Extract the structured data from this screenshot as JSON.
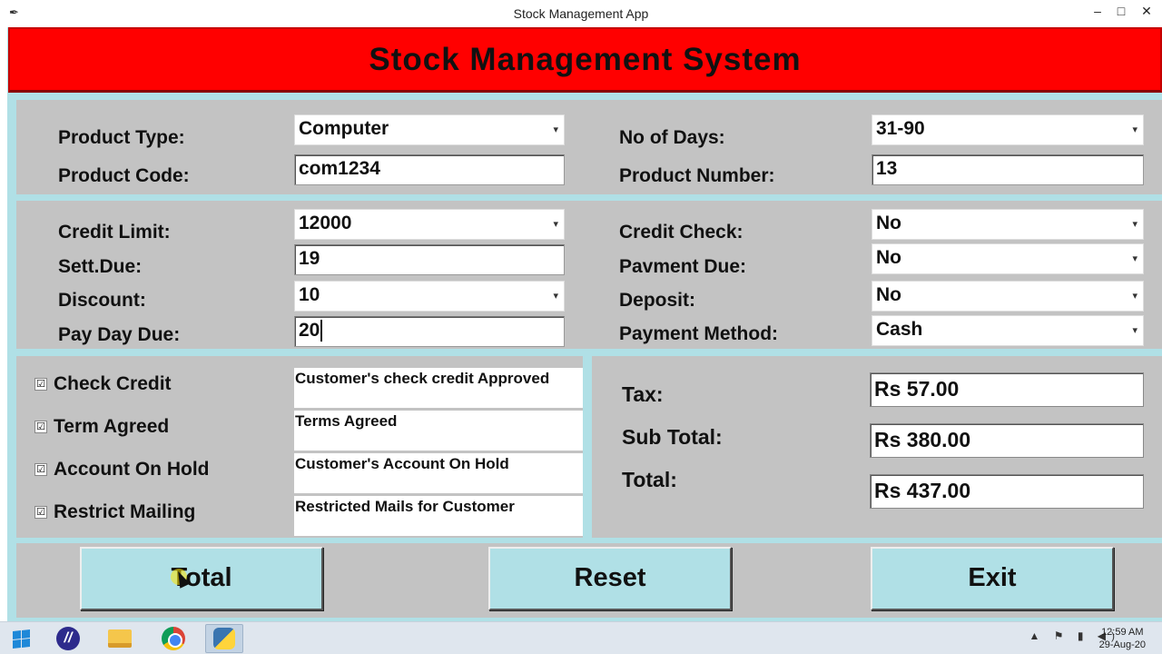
{
  "window": {
    "title": "Stock Management App",
    "minimize": "–",
    "maximize": "□",
    "close": "✕"
  },
  "app": {
    "heading": "Stock Management System"
  },
  "product": {
    "type_label": "Product Type:",
    "type_value": "Computer",
    "code_label": "Product Code:",
    "code_value": "com1234",
    "days_label": "No of Days:",
    "days_value": "31-90",
    "number_label": "Product Number:",
    "number_value": "13"
  },
  "credit": {
    "limit_label": "Credit Limit:",
    "limit_value": "12000",
    "sett_label": "Sett.Due:",
    "sett_value": "19",
    "discount_label": "Discount:",
    "discount_value": "10",
    "payday_label": "Pay Day Due:",
    "payday_value": "20",
    "check_label": "Credit Check:",
    "check_value": "No",
    "paydue_label": "Pavment Due:",
    "paydue_value": "No",
    "deposit_label": "Deposit:",
    "deposit_value": "No",
    "method_label": "Payment Method:",
    "method_value": "Cash"
  },
  "options": [
    {
      "label": "Check Credit",
      "checked": true,
      "message": "Customer's check credit Approved"
    },
    {
      "label": "Term Agreed",
      "checked": true,
      "message": "Terms Agreed"
    },
    {
      "label": "Account On Hold",
      "checked": true,
      "message": "Customer's Account On Hold"
    },
    {
      "label": "Restrict Mailing",
      "checked": true,
      "message": "Restricted Mails for Customer"
    }
  ],
  "check_mark": "☑",
  "dropdown_arrow": "▾",
  "totals": {
    "tax_label": "Tax:",
    "tax_value": "Rs 57.00",
    "subtotal_label": "Sub Total:",
    "subtotal_value": "Rs 380.00",
    "total_label": "Total:",
    "total_value": "Rs 437.00"
  },
  "buttons": {
    "total": "Total",
    "reset": "Reset",
    "exit": "Exit"
  },
  "taskbar": {
    "eclipse_glyph": "//",
    "tray_icons": "▲ ⚑ ▮ ◀)",
    "time": "12:59 AM",
    "date": "29-Aug-20"
  },
  "colors": {
    "banner": "#ff0000",
    "frame": "#b0e0e6",
    "panel": "#c3c3c3",
    "button": "#b0e0e6"
  }
}
